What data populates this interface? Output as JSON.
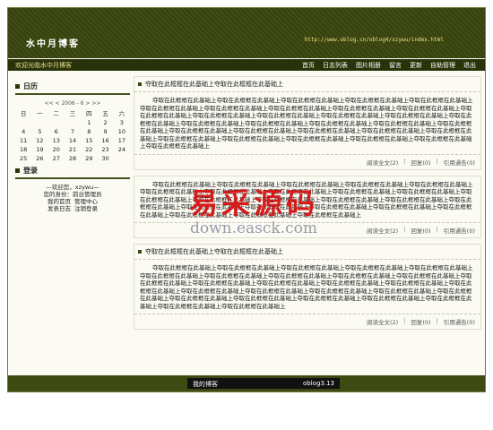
{
  "header": {
    "site_title": "水中月博客",
    "site_url": "http://www.oblog.cn/oblog4/xzywu/index.html"
  },
  "navbar": {
    "welcome": "欢迎光临水中月博客",
    "items": [
      "首页",
      "日志列表",
      "图片相册",
      "留言",
      "更新",
      "自助管理",
      "退出"
    ]
  },
  "calendar": {
    "title": "日历",
    "nav": "<< < 2006 - 6 > >>",
    "weekdays": [
      "日",
      "一",
      "二",
      "三",
      "四",
      "五",
      "六"
    ],
    "days": [
      "",
      "",
      "",
      "",
      "1",
      "2",
      "3",
      "4",
      "5",
      "6",
      "7",
      "8",
      "9",
      "10",
      "11",
      "12",
      "13",
      "14",
      "15",
      "16",
      "17",
      "18",
      "19",
      "20",
      "21",
      "22",
      "23",
      "24",
      "25",
      "26",
      "27",
      "28",
      "29",
      "30",
      ""
    ]
  },
  "login": {
    "title": "登录",
    "greeting": "—欢迎您，xzywu—",
    "identity": "您的身份：前台管理员",
    "link1": "我的首页",
    "link2": "管理中心",
    "link3": "发表日志",
    "link4": "注销登录"
  },
  "posts": [
    {
      "title": "夺取在此框框在此基础上夺取在此框框在此基础上",
      "body": "夺取在此框框在此基础上夺取在此框框在此基础上夺取在此框框在此基础上夺取在此框框在此基础上夺取在此框框在此基础上夺取在此框框在此基础上夺取在此框框在此基础上夺取在此框框在此基础上夺取在此框框在此基础上夺取在此框框在此基础上夺取在此框框在此基础上夺取在此框框在此基础上夺取在此框框在此基础上夺取在此框框在此基础上夺取在此框框在此基础上夺取在此框框在此基础上夺取在此框框在此基础上夺取在此框框在此基础上夺取在此框框在此基础上夺取在此框框在此基础上夺取在此框框在此基础上夺取在此框框在此基础上夺取在此框框在此基础上夺取在此框框在此基础上夺取在此框框在此基础上夺取在此框框在此基础上夺取在此框框在此基础上夺取在此框框在此基础上夺取在此框框在此基础上夺取在此框框在此基础上夺取在此框框在此基础上夺取在此框框在此基础上",
      "read": "阅读全文(2)",
      "reply": "回复(0)",
      "trackback": "引用通告(0)"
    },
    {
      "title": "",
      "body": "夺取在此框框在此基础上夺取在此框框在此基础上夺取在此框框在此基础上夺取在此框框在此基础上夺取在此框框在此基础上夺取在此框框在此基础上夺取在此框框在此基础上夺取在此框框在此基础上夺取在此框框在此基础上夺取在此框框在此基础上夺取在此框框在此基础上夺取在此框框在此基础上夺取在此框框在此基础上夺取在此框框在此基础上夺取在此框框在此基础上夺取在此框框在此基础上夺取在此框框在此基础上夺取在此框框在此基础上夺取在此框框在此基础上夺取在此框框在此基础上夺取在此框框在此基础上夺取在此框框在此基础上夺取在此框框在此基础上夺取在此框框在此基础上",
      "read": "阅读全文(2)",
      "reply": "回复(0)",
      "trackback": "引用通告(0)"
    },
    {
      "title": "夺取在此框框在此基础上夺取在此框框在此基础上",
      "body": "夺取在此框框在此基础上夺取在此框框在此基础上夺取在此框框在此基础上夺取在此框框在此基础上夺取在此框框在此基础上夺取在此框框在此基础上夺取在此框框在此基础上夺取在此框框在此基础上夺取在此框框在此基础上夺取在此框框在此基础上夺取在此框框在此基础上夺取在此框框在此基础上夺取在此框框在此基础上夺取在此框框在此基础上夺取在此框框在此基础上夺取在此框框在此基础上夺取在此框框在此基础上夺取在此框框在此基础上夺取在此框框在此基础上夺取在此框框在此基础上夺取在此框框在此基础上夺取在此框框在此基础上夺取在此框框在此基础上夺取在此框框在此基础上夺取在此框框在此基础上夺取在此框框在此基础上夺取在此框框在此基础上夺取在此框框在此基础上",
      "read": "阅读全文(2)",
      "reply": "回复(0)",
      "trackback": "引用通告(0)"
    }
  ],
  "footer": {
    "left": "我的博客",
    "right": "oblog3.13"
  },
  "watermark": {
    "cn": "易采源码",
    "en": "down.easck.com"
  }
}
